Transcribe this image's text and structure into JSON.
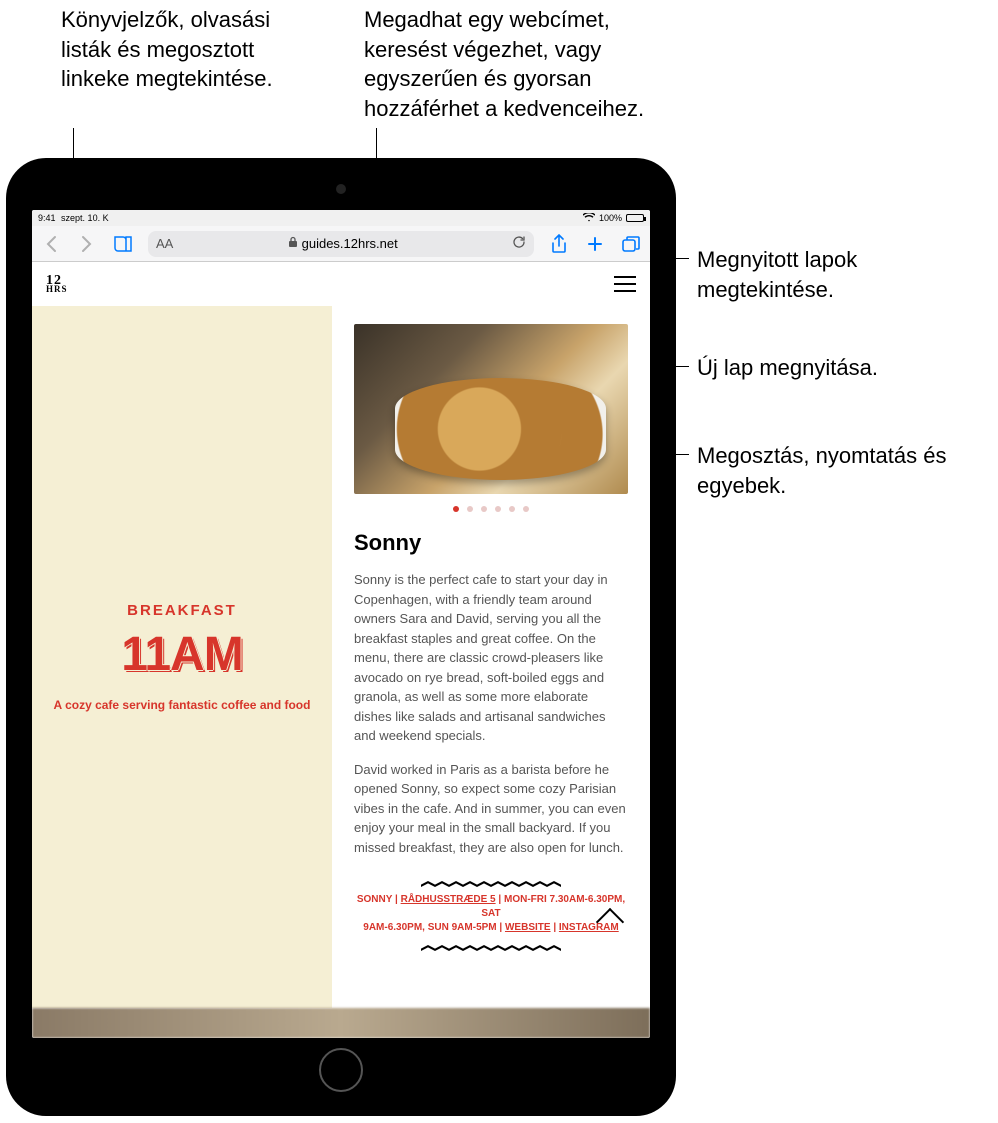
{
  "callouts": {
    "bookmarks": "Könyvjelzők, olvasási listák és megosztott linkeke megtekintése.",
    "address": "Megadhat egy webcímet, keresést végezhet, vagy egyszerűen és gyorsan hozzáférhet a kedvenceihez.",
    "tabs": "Megnyitott lapok megtekintése.",
    "newtab": "Új lap megnyitása.",
    "share": "Megosztás, nyomtatás és egyebek."
  },
  "status": {
    "time": "9:41",
    "date": "szept. 10. K",
    "battery_pct": "100%"
  },
  "toolbar": {
    "aa": "AA",
    "url": "guides.12hrs.net"
  },
  "site": {
    "logo_line1": "12",
    "logo_line2": "HRS"
  },
  "left": {
    "label": "BREAKFAST",
    "time": "11AM",
    "sub": "A cozy cafe serving fantastic coffee and food"
  },
  "article": {
    "title": "Sonny",
    "p1": "Sonny is the perfect cafe to start your day in Copenhagen, with a friendly team around owners Sara and David, serving you all the breakfast staples and great coffee. On the menu, there are classic crowd-pleasers like avocado on rye bread, soft-boiled eggs and granola, as well as some more elaborate dishes like salads and artisanal sandwiches and weekend specials.",
    "p2": "David worked in Paris as a barista before he opened Sonny, so expect some cozy Parisian vibes in the cafe. And in summer, you can even enjoy your meal in the small backyard. If you missed breakfast, they are also open for lunch.",
    "info1_a": "SONNY",
    "info1_b": "RÅDHUSSTRÆDE 5",
    "info1_c": "MON-FRI 7.30AM-6.30PM, SAT",
    "info2_a": "9AM-6.30PM, SUN 9AM-5PM",
    "info2_b": "WEBSITE",
    "info2_c": "INSTAGRAM"
  }
}
